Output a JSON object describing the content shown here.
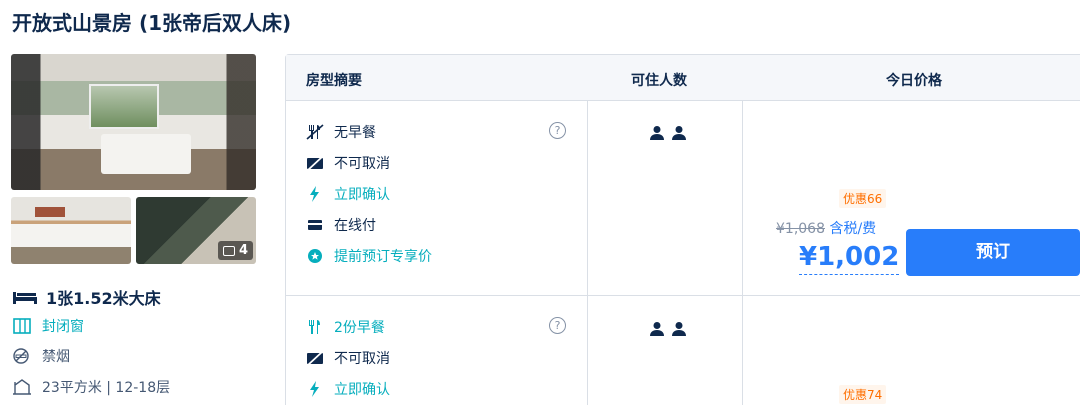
{
  "room": {
    "title": "开放式山景房 (1张帝后双人床)",
    "photo_count": "4",
    "bed": "1张1.52米大床",
    "window": "封闭窗",
    "smoking": "禁烟",
    "area": "23平方米 | 12-18层"
  },
  "table": {
    "headers": [
      "房型摘要",
      "可住人数",
      "今日价格"
    ]
  },
  "offers": [
    {
      "features": [
        {
          "icon": "no-breakfast-icon",
          "text": "无早餐",
          "color": "dark"
        },
        {
          "icon": "no-cancel-icon",
          "text": "不可取消",
          "color": "dark"
        },
        {
          "icon": "lightning-icon",
          "text": "立即确认",
          "color": "green"
        },
        {
          "icon": "card-icon",
          "text": "在线付",
          "color": "dark"
        },
        {
          "icon": "star-badge-icon",
          "text": "提前预订专享价",
          "color": "green"
        }
      ],
      "info": "?",
      "discount": "优惠66",
      "original_price": "¥1,068",
      "tax_label": "含税/费",
      "price": "¥1,002",
      "book_label": "预订"
    },
    {
      "features": [
        {
          "icon": "breakfast-icon",
          "text": "2份早餐",
          "color": "green"
        },
        {
          "icon": "no-cancel-icon",
          "text": "不可取消",
          "color": "dark"
        },
        {
          "icon": "lightning-icon",
          "text": "立即确认",
          "color": "green"
        }
      ],
      "info": "?",
      "discount": "优惠74"
    }
  ],
  "colors": {
    "accent": "#287dfa",
    "green": "#06aebd",
    "orange": "#ff6f00",
    "text": "#0f294d"
  }
}
